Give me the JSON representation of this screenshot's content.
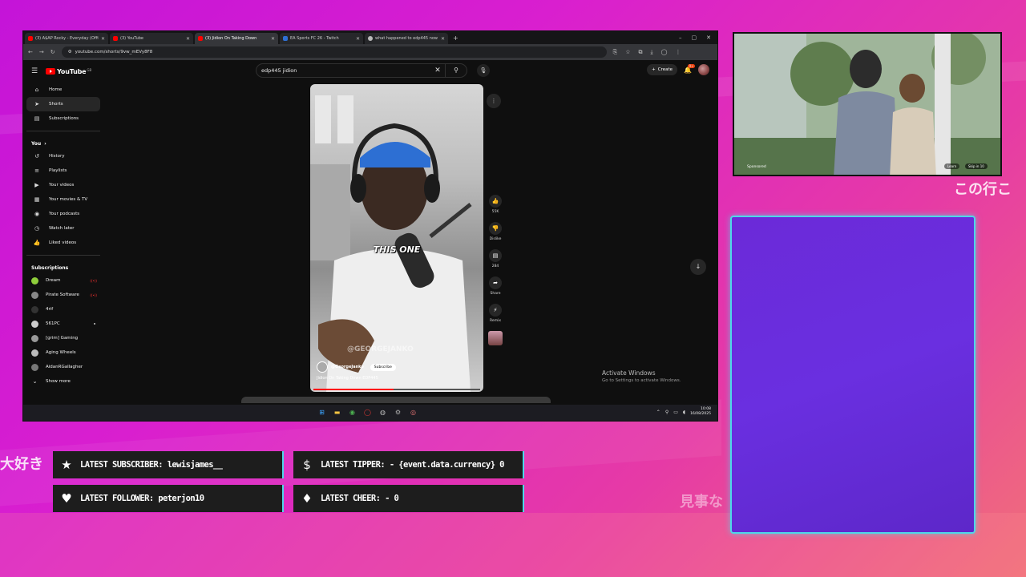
{
  "browser": {
    "tabs": [
      {
        "title": "(3) A$AP Rocky - Everyday (Offi",
        "active": false,
        "kind": "yt"
      },
      {
        "title": "(3) YouTube",
        "active": false,
        "kind": "yt"
      },
      {
        "title": "(3) Jidion On Taking Down",
        "active": true,
        "kind": "yt"
      },
      {
        "title": "EA Sports FC 26 - Twitch",
        "active": false,
        "kind": "tw"
      },
      {
        "title": "what happened to edp445 now",
        "active": false,
        "kind": "g"
      }
    ],
    "url": "youtube.com/shorts/9vw_mEVy8F8"
  },
  "youtube": {
    "logo_text": "YouTube",
    "logo_region": "GB",
    "search_query": "edp445 jidion",
    "create_label": "Create",
    "notif_count": "9+",
    "sidebar": {
      "main": [
        {
          "label": "Home",
          "icon": "⌂",
          "name": "home"
        },
        {
          "label": "Shorts",
          "icon": "➤",
          "name": "shorts",
          "active": true
        },
        {
          "label": "Subscriptions",
          "icon": "▤",
          "name": "subscriptions"
        }
      ],
      "you_header": "You",
      "you": [
        {
          "label": "History",
          "icon": "↺",
          "name": "history"
        },
        {
          "label": "Playlists",
          "icon": "≡",
          "name": "playlists"
        },
        {
          "label": "Your videos",
          "icon": "▶",
          "name": "your-videos"
        },
        {
          "label": "Your movies & TV",
          "icon": "▦",
          "name": "your-movies"
        },
        {
          "label": "Your podcasts",
          "icon": "◉",
          "name": "your-podcasts"
        },
        {
          "label": "Watch later",
          "icon": "◷",
          "name": "watch-later"
        },
        {
          "label": "Liked videos",
          "icon": "👍",
          "name": "liked-videos"
        }
      ],
      "subs_header": "Subscriptions",
      "subscriptions": [
        {
          "label": "Dream",
          "badge": "live",
          "color": "#8fce3b"
        },
        {
          "label": "Pirate Software",
          "badge": "live",
          "color": "#888"
        },
        {
          "label": "4rif",
          "badge": "",
          "color": "#333"
        },
        {
          "label": "561PC",
          "badge": "dot",
          "color": "#ccc"
        },
        {
          "label": "[grim] Gaming",
          "badge": "",
          "color": "#999"
        },
        {
          "label": "Aging Wheels",
          "badge": "",
          "color": "#bbb"
        },
        {
          "label": "AidanRGallagher",
          "badge": "",
          "color": "#777"
        }
      ],
      "show_more": "Show more"
    },
    "short": {
      "caption": "THIS ONE",
      "watermark": "@GEORGEJANKO",
      "channel": "@GeorgeJanko",
      "subscribe": "Subscribe",
      "title": "Jidion On Taking Down EDP445",
      "progress": 0.48
    },
    "actions": [
      {
        "name": "like",
        "icon": "👍",
        "label": "55K"
      },
      {
        "name": "dislike",
        "icon": "👎",
        "label": "Dislike"
      },
      {
        "name": "comments",
        "icon": "▤",
        "label": "284"
      },
      {
        "name": "share",
        "icon": "➦",
        "label": "Share"
      },
      {
        "name": "remix",
        "icon": "⚡",
        "label": "Remix"
      }
    ],
    "activate": {
      "line1": "Activate Windows",
      "line2": "Go to Settings to activate Windows."
    }
  },
  "taskbar": {
    "time": "10:08",
    "date": "16/08/2025"
  },
  "ad": {
    "sponsored": "Sponsored",
    "learn": "Learn",
    "skip": "Skip in  10"
  },
  "overlay": {
    "jp_top": "この行こ",
    "jp_left": "大好き",
    "jp_bottom": "見事な",
    "stats": [
      {
        "name": "latest-subscriber",
        "icon": "★",
        "text": "LATEST SUBSCRIBER: lewisjames__"
      },
      {
        "name": "latest-tipper",
        "icon": "$",
        "text": "LATEST TIPPER:  - {event.data.currency} 0"
      },
      {
        "name": "latest-follower",
        "icon": "♥",
        "text": "LATEST FOLLOWER: peterjon10"
      },
      {
        "name": "latest-cheer",
        "icon": "♦",
        "text": "LATEST CHEER:  - 0"
      }
    ]
  }
}
